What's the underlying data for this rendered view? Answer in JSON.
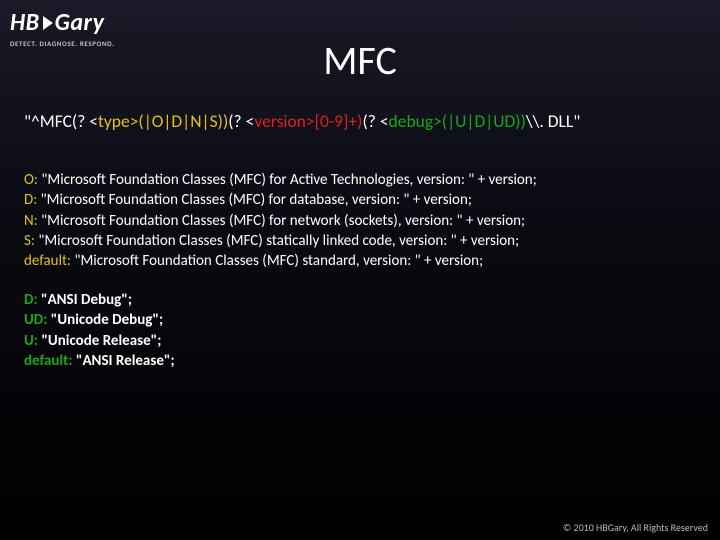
{
  "logo": {
    "brand_left": "HB",
    "brand_right": "Gary",
    "tagline": "DETECT. DIAGNOSE. RESPOND."
  },
  "title": "MFC",
  "regex": {
    "prefix": "\"^MFC(? <",
    "type_kw": "type",
    "type_alts": ">(|O|D|N|S))",
    "mid1": "(? <",
    "version_kw": "version",
    "version_alts": ">[0-9]+)",
    "mid2": "(? <",
    "debug_kw": "debug",
    "debug_alts": ">(|U|D|UD))",
    "suffix": "\\\\. DLL\""
  },
  "type_map": {
    "rows": [
      {
        "key": "O:",
        "val": "\"Microsoft Foundation Classes (MFC) for Active Technologies, version: \" + version;"
      },
      {
        "key": "D:",
        "val": "\"Microsoft Foundation Classes (MFC) for database, version: \" + version;"
      },
      {
        "key": "N:",
        "val": "\"Microsoft Foundation Classes (MFC) for network (sockets), version: \" + version;"
      },
      {
        "key": "S:",
        "val": " \"Microsoft Foundation Classes (MFC) statically linked code, version: \" + version;"
      },
      {
        "key": "default:",
        "val": "  \"Microsoft Foundation Classes (MFC) standard, version: \" + version;"
      }
    ]
  },
  "debug_map": {
    "rows": [
      {
        "key": "D:",
        "val": "\"ANSI Debug\";"
      },
      {
        "key": "UD:",
        "val": "\"Unicode Debug\";"
      },
      {
        "key": "U:",
        "val": " \"Unicode Release\";"
      },
      {
        "key": "default:",
        "val": " \"ANSI Release\";"
      }
    ]
  },
  "footer": "© 2010 HBGary, All Rights Reserved"
}
